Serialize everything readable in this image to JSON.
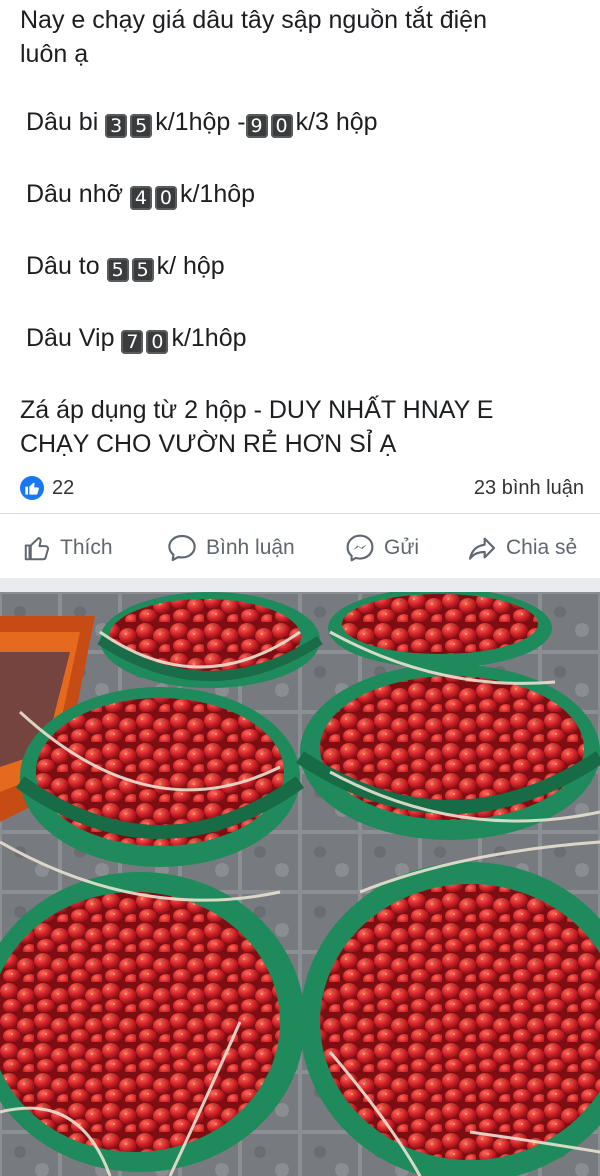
{
  "post": {
    "line1": "Nay e chạy giá dâu tây sập nguồn tắt điện",
    "line2": "luôn ạ",
    "items": [
      {
        "prefix": "Dâu bi ",
        "digits1": [
          "3",
          "5"
        ],
        "mid": "k/1hộp -",
        "digits2": [
          "9",
          "0"
        ],
        "suffix": "k/3 hộp"
      },
      {
        "prefix": "Dâu nhỡ ",
        "digits1": [
          "4",
          "0"
        ],
        "mid": "k/1hôp"
      },
      {
        "prefix": "Dâu to ",
        "digits1": [
          "5",
          "5"
        ],
        "mid": "k/ hộp"
      },
      {
        "prefix": "Dâu Vip ",
        "digits1": [
          "7",
          "0"
        ],
        "mid": "k/1hôp"
      }
    ],
    "note1": " Zá áp dụng từ 2 hộp - DUY NHẤT HNAY E",
    "note2": "CHẠY CHO VƯỜN RẺ HƠN SỈ Ạ"
  },
  "stats": {
    "like_count": "22",
    "comment_count": "23 bình luận"
  },
  "actions": {
    "like": "Thích",
    "comment": "Bình luận",
    "send": "Gửi",
    "share": "Chia sẻ"
  },
  "colors": {
    "accent": "#1877f2",
    "action_text": "#606770",
    "basin": "#1f8a5b",
    "strawberry": "#d3222a"
  },
  "icons": [
    "like-badge-icon",
    "thumb-up-icon",
    "comment-bubble-icon",
    "messenger-icon",
    "share-arrow-icon"
  ]
}
